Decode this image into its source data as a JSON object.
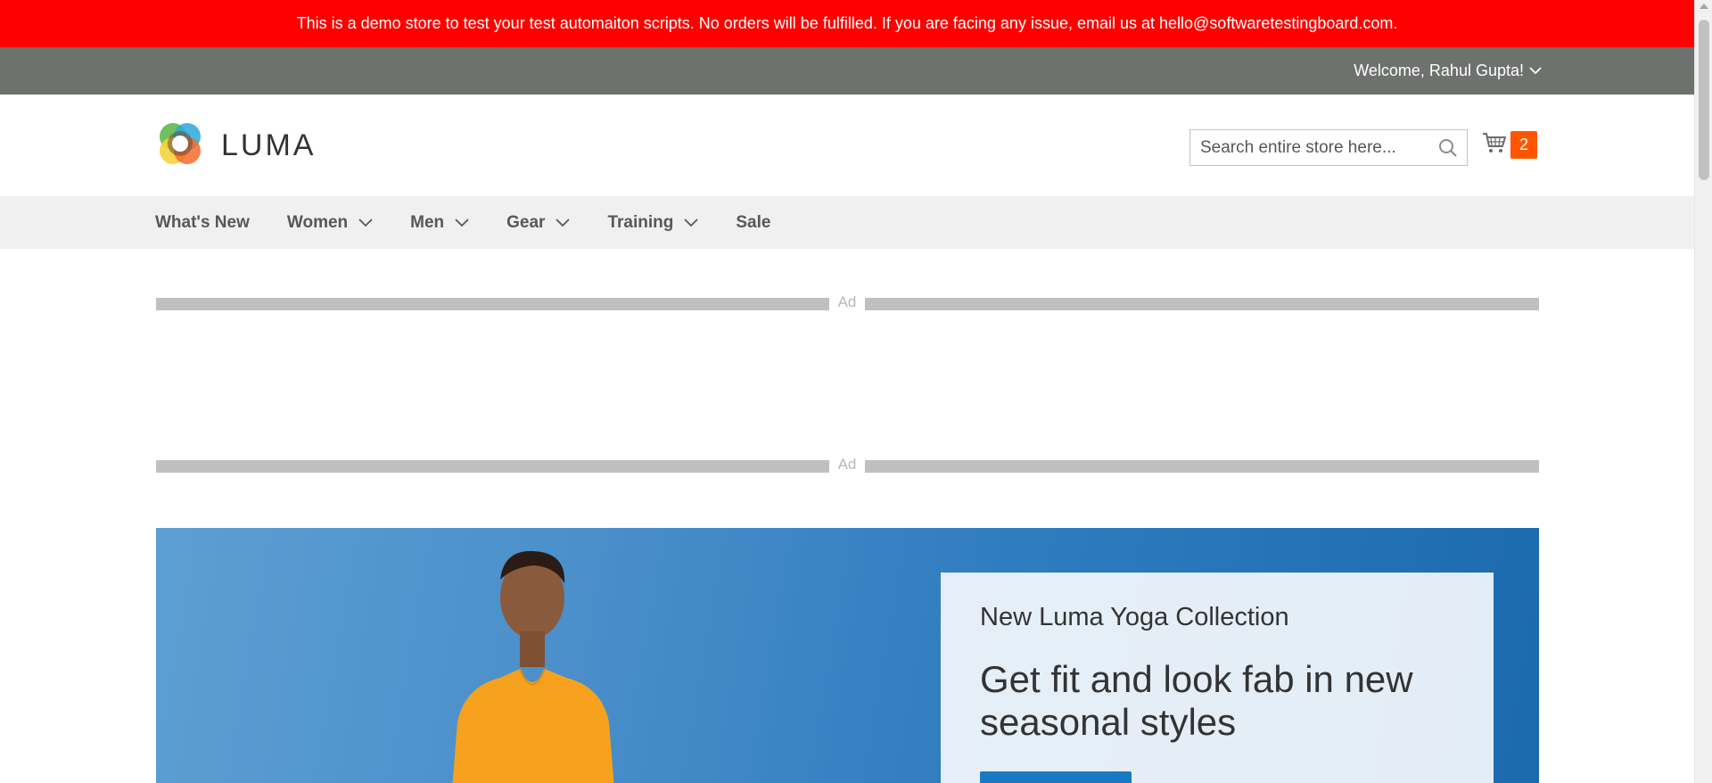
{
  "banner": {
    "text": "This is a demo store to test your test automaiton scripts. No orders will be fulfilled. If you are facing any issue, email us at hello@softwaretestingboard.com."
  },
  "account": {
    "welcome": "Welcome, Rahul Gupta!"
  },
  "header": {
    "logo_text": "LUMA",
    "search_placeholder": "Search entire store here...",
    "cart_count": "2"
  },
  "nav": {
    "items": [
      {
        "label": "What's New",
        "has_dropdown": false
      },
      {
        "label": "Women",
        "has_dropdown": true
      },
      {
        "label": "Men",
        "has_dropdown": true
      },
      {
        "label": "Gear",
        "has_dropdown": true
      },
      {
        "label": "Training",
        "has_dropdown": true
      },
      {
        "label": "Sale",
        "has_dropdown": false
      }
    ]
  },
  "ads": {
    "label": "Ad"
  },
  "hero": {
    "kicker": "New Luma Yoga Collection",
    "headline": "Get fit and look fab in new seasonal styles"
  },
  "colors": {
    "banner_bg": "#ff0000",
    "welcome_bar_bg": "#6e716e",
    "nav_bg": "#f0f0f0",
    "cart_badge": "#ff5501",
    "hero_button": "#1979c3"
  },
  "icons": {
    "search": "search-icon",
    "cart": "cart-icon",
    "dropdown": "chevron-down-icon",
    "logo": "luma-logo-icon"
  }
}
